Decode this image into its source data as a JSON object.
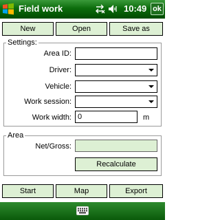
{
  "titlebar": {
    "title": "Field work",
    "time": "10:49",
    "ok_label": "ok",
    "status_icons": "⇄✕ ◀│",
    "icons": [
      "windows-start-icon",
      "connectivity-icon",
      "volume-icon"
    ]
  },
  "toolbar": {
    "new_label": "New",
    "open_label": "Open",
    "save_as_label": "Save as"
  },
  "settings": {
    "group_title": "Settings:",
    "area_id_label": "Area ID:",
    "area_id_value": "",
    "driver_label": "Driver:",
    "driver_value": "",
    "vehicle_label": "Vehicle:",
    "vehicle_value": "",
    "work_session_label": "Work session:",
    "work_session_value": "",
    "work_width_label": "Work width:",
    "work_width_value": "0",
    "work_width_unit": "m"
  },
  "area": {
    "group_title": "Area",
    "net_gross_label": "Net/Gross:",
    "net_gross_value": "",
    "recalculate_label": "Recalculate"
  },
  "actions": {
    "start_label": "Start",
    "map_label": "Map",
    "export_label": "Export"
  },
  "bottombar": {
    "icon": "keyboard-icon"
  },
  "colors": {
    "titlebar": "#0c6c0c",
    "button_bg": "#ddf0d4",
    "bottombar": "#0a5a0a"
  }
}
